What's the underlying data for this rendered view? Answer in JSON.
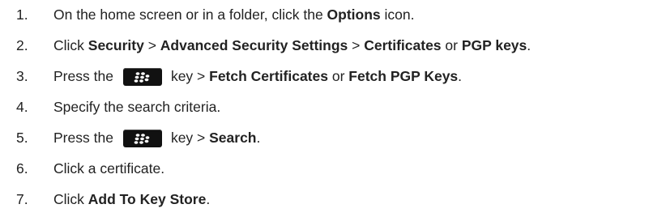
{
  "colors": {
    "text": "#222222",
    "menu_key_bg": "#111111",
    "menu_key_dots": "#ffffff"
  },
  "steps": [
    {
      "number": "1.",
      "parts": {
        "a": "On the home screen or in a folder, click the ",
        "b": "Options",
        "c": " icon."
      }
    },
    {
      "number": "2.",
      "parts": {
        "a": "Click ",
        "b": "Security",
        "c": " > ",
        "d": "Advanced Security Settings",
        "e": " > ",
        "f": "Certificates",
        "g": " or ",
        "h": "PGP keys",
        "i": "."
      }
    },
    {
      "number": "3.",
      "icon": "blackberry-menu-key-icon",
      "parts": {
        "a": "Press the",
        "b": "key > ",
        "c": "Fetch Certificates",
        "d": " or ",
        "e": "Fetch PGP Keys",
        "f": "."
      }
    },
    {
      "number": "4.",
      "parts": {
        "a": "Specify the search criteria."
      }
    },
    {
      "number": "5.",
      "icon": "blackberry-menu-key-icon",
      "parts": {
        "a": "Press the",
        "b": "key > ",
        "c": "Search",
        "d": "."
      }
    },
    {
      "number": "6.",
      "parts": {
        "a": "Click a certificate."
      }
    },
    {
      "number": "7.",
      "parts": {
        "a": "Click ",
        "b": "Add To Key Store",
        "c": "."
      }
    }
  ]
}
